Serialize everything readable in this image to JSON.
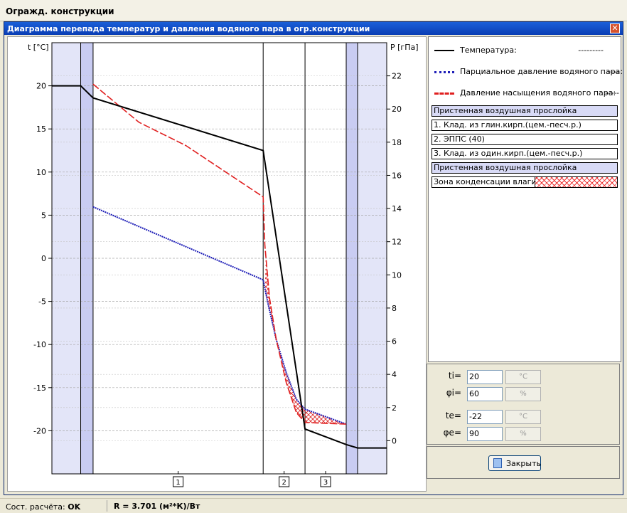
{
  "window": {
    "title": "Огражд. конструкции"
  },
  "dialog": {
    "title": "Диаграмма перепада температур и давления водяного пара в огр.конструкции",
    "close_symbol": "✕"
  },
  "chart_data": {
    "type": "line",
    "left_axis": {
      "label": "t [°C]",
      "ylim": [
        -25,
        25
      ],
      "ticks": [
        20,
        15,
        10,
        5,
        0,
        -5,
        -10,
        -15,
        -20
      ]
    },
    "right_axis": {
      "label": "P [гПа]",
      "ylim": [
        -2,
        24
      ],
      "ticks": [
        22,
        20,
        18,
        16,
        14,
        12,
        10,
        8,
        6,
        4,
        2,
        0
      ]
    },
    "x_domain": [
      0,
      100
    ],
    "layer_bounds": [
      8.6,
      12.3,
      63.1,
      75.6,
      87.9,
      91.3
    ],
    "layer_labels": [
      "1",
      "2",
      "3"
    ],
    "series": [
      {
        "name": "Температура",
        "axis": "left",
        "color": "#000000",
        "x": [
          0,
          8.6,
          12.3,
          63.1,
          75.6,
          87.9,
          91.3,
          100
        ],
        "y": [
          20,
          20,
          18.6,
          12.5,
          -19.8,
          -21.6,
          -22,
          -22
        ]
      },
      {
        "name": "Парциальное давление водяного пара",
        "axis": "right",
        "color": "#1f1fb8",
        "x": [
          12.3,
          63.1,
          64.5,
          67,
          70,
          73,
          75.6,
          87.9
        ],
        "y": [
          14.1,
          9.7,
          8.3,
          6.1,
          4.1,
          2.5,
          1.9,
          1.0
        ]
      },
      {
        "name": "Давление насыщения водяного пара",
        "axis": "right",
        "color": "#e02020",
        "x": [
          12.3,
          26,
          40,
          63.1,
          63.6,
          65,
          67,
          70,
          73,
          75.6,
          87.9
        ],
        "y": [
          21.5,
          19.2,
          17.8,
          14.7,
          11.8,
          8.6,
          6.1,
          3.5,
          1.7,
          1.1,
          1.0
        ]
      }
    ]
  },
  "legend": {
    "items": [
      {
        "label": "Температура:",
        "value": "---------",
        "color": "#000000"
      },
      {
        "label": "Парциальное давление водяного пара:",
        "value": "----",
        "color": "#1f1fb8"
      },
      {
        "label": "Давление насыщения водяного пара:",
        "value": "-----",
        "color": "#e02020"
      }
    ],
    "layers": [
      {
        "label": "Пристенная воздушная прослойка",
        "kind": "air"
      },
      {
        "label": "1. Клад. из глин.кирп.(цем.-песч.р.)",
        "kind": "norm"
      },
      {
        "label": "2. ЭППС  (40)",
        "kind": "norm"
      },
      {
        "label": "3. Клад. из один.кирп.(цем.-песч.р.)",
        "kind": "norm"
      },
      {
        "label": "Пристенная воздушная прослойка",
        "kind": "air"
      }
    ],
    "condensation_label": "Зона конденсации влаги ->"
  },
  "params": {
    "ti": {
      "label": "ti=",
      "value": "20",
      "unit": "°C"
    },
    "phii": {
      "label": "φi=",
      "value": "60",
      "unit": "%"
    },
    "te": {
      "label": "te=",
      "value": "-22",
      "unit": "°C"
    },
    "phie": {
      "label": "φe=",
      "value": "90",
      "unit": "%"
    }
  },
  "buttons": {
    "close_label": "Закрыть"
  },
  "status": {
    "calc_label": "Сост. расчёта:",
    "calc_value": "OK",
    "resistance_text": "R = 3.701 (м²*К)/Вт"
  }
}
